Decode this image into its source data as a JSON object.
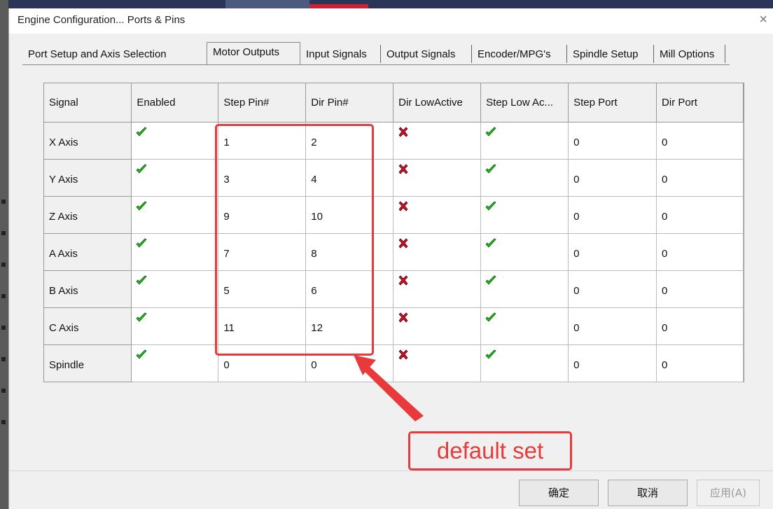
{
  "window": {
    "title": "Engine Configuration... Ports & Pins",
    "close_glyph": "×"
  },
  "tabs": [
    {
      "label": "Port Setup and Axis Selection"
    },
    {
      "label": "Motor Outputs",
      "active": true
    },
    {
      "label": "Input Signals"
    },
    {
      "label": "Output Signals"
    },
    {
      "label": "Encoder/MPG's"
    },
    {
      "label": "Spindle Setup"
    },
    {
      "label": "Mill Options"
    }
  ],
  "table": {
    "columns": [
      "Signal",
      "Enabled",
      "Step Pin#",
      "Dir Pin#",
      "Dir LowActive",
      "Step Low Ac...",
      "Step Port",
      "Dir Port"
    ],
    "rows": [
      {
        "signal": "X Axis",
        "enabled": true,
        "step_pin": "1",
        "dir_pin": "2",
        "dir_low_active": false,
        "step_low_active": true,
        "step_port": "0",
        "dir_port": "0"
      },
      {
        "signal": "Y Axis",
        "enabled": true,
        "step_pin": "3",
        "dir_pin": "4",
        "dir_low_active": false,
        "step_low_active": true,
        "step_port": "0",
        "dir_port": "0"
      },
      {
        "signal": "Z Axis",
        "enabled": true,
        "step_pin": "9",
        "dir_pin": "10",
        "dir_low_active": false,
        "step_low_active": true,
        "step_port": "0",
        "dir_port": "0"
      },
      {
        "signal": "A Axis",
        "enabled": true,
        "step_pin": "7",
        "dir_pin": "8",
        "dir_low_active": false,
        "step_low_active": true,
        "step_port": "0",
        "dir_port": "0"
      },
      {
        "signal": "B Axis",
        "enabled": true,
        "step_pin": "5",
        "dir_pin": "6",
        "dir_low_active": false,
        "step_low_active": true,
        "step_port": "0",
        "dir_port": "0"
      },
      {
        "signal": "C Axis",
        "enabled": true,
        "step_pin": "11",
        "dir_pin": "12",
        "dir_low_active": false,
        "step_low_active": true,
        "step_port": "0",
        "dir_port": "0"
      },
      {
        "signal": "Spindle",
        "enabled": true,
        "step_pin": "0",
        "dir_pin": "0",
        "dir_low_active": false,
        "step_low_active": true,
        "step_port": "0",
        "dir_port": "0"
      }
    ]
  },
  "icons": {
    "enabled": "green-check-icon",
    "disabled": "red-x-icon"
  },
  "colors": {
    "check": "#22c01e",
    "cross": "#c8102e",
    "annotation": "#e83a3a"
  },
  "annotation": {
    "label": "default set"
  },
  "buttons": {
    "ok": "确定",
    "cancel": "取消",
    "apply": "应用(A)"
  }
}
